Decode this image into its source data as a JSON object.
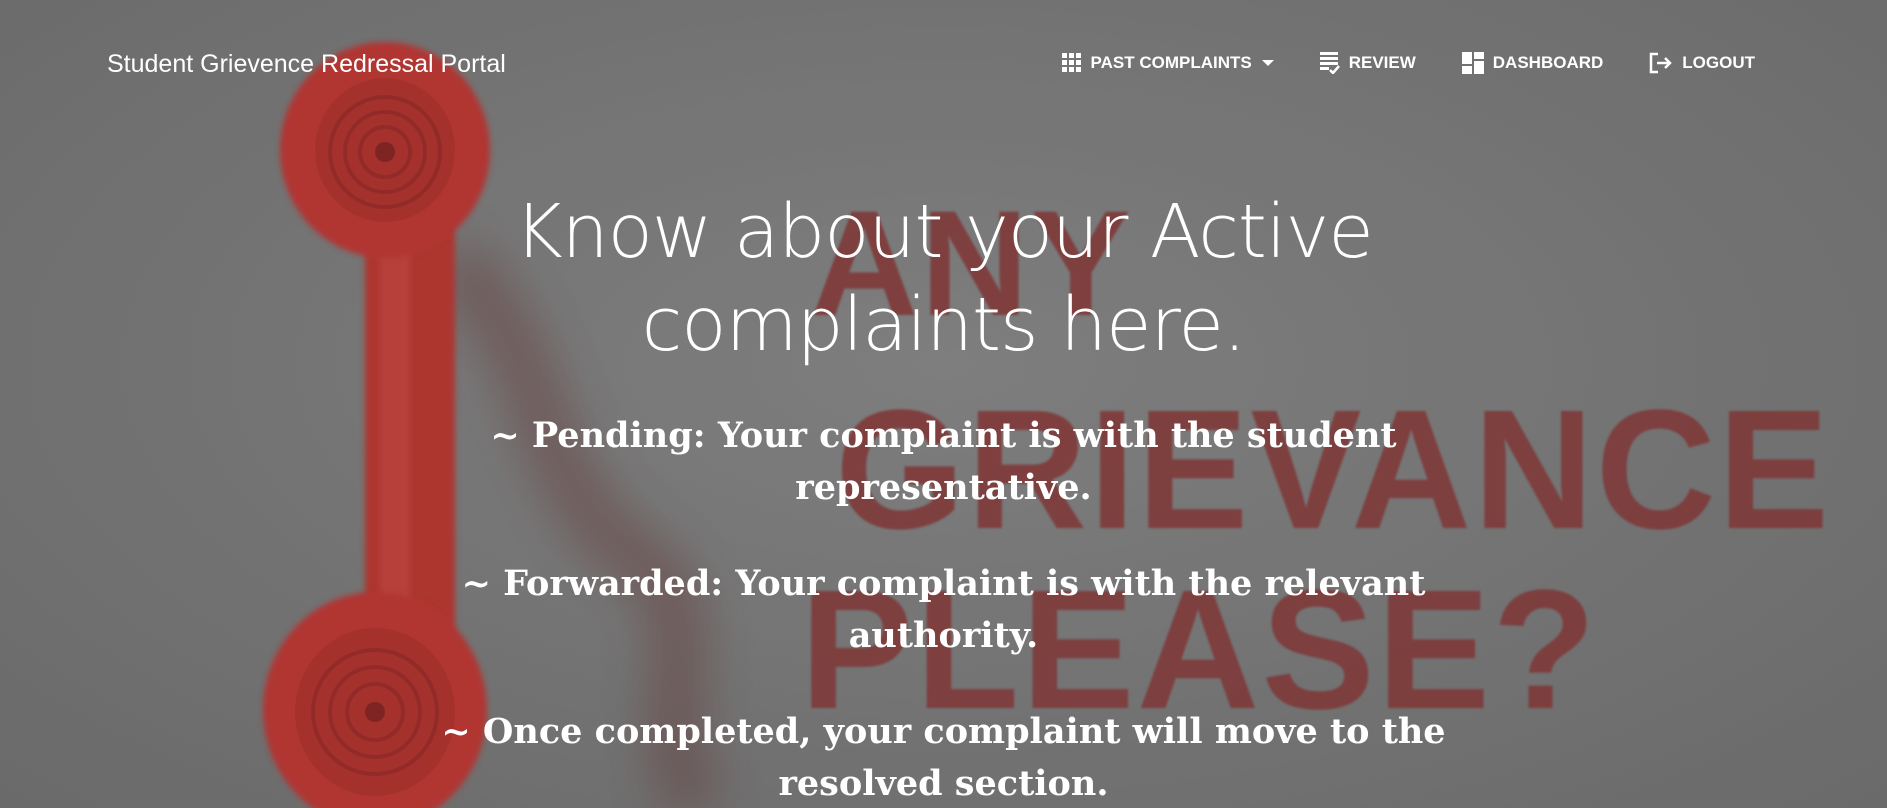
{
  "brand": {
    "title": "Student Grievence Redressal Portal"
  },
  "nav": {
    "past_complaints": "PAST COMPLAINTS",
    "review": "REVIEW",
    "dashboard": "DASHBOARD",
    "logout": "LOGOUT"
  },
  "hero": {
    "title": "Know about your Active complaints here.",
    "status_lines": [
      "~ Pending: Your complaint is with the student representative.",
      "~ Forwarded: Your complaint is with the relevant authority.",
      "~ Once completed, your complaint will move to the resolved section."
    ]
  },
  "background_art": {
    "words": [
      "ANY",
      "GRIEVANCE",
      "PLEASE?"
    ],
    "colors": {
      "text": "#8c3232",
      "phone": "#c6332f",
      "backdrop": "#7b7b7b"
    }
  }
}
